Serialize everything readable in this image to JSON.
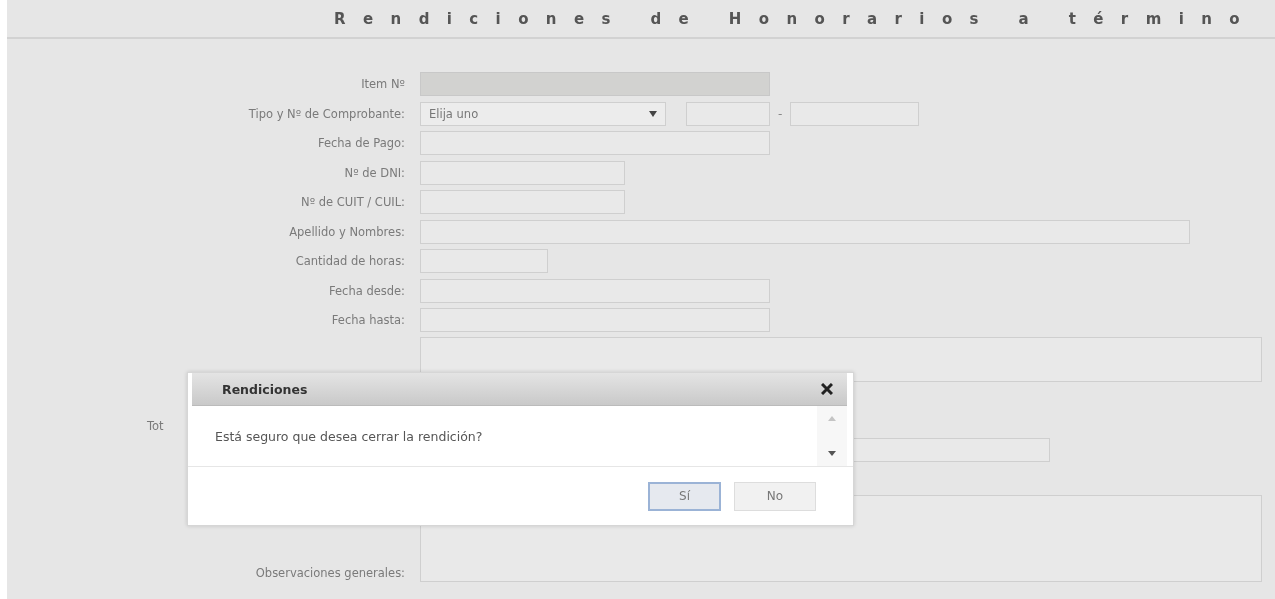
{
  "title": "Rendiciones de Honorarios a término",
  "form": [
    {
      "kind": "medium",
      "label": "Item Nº",
      "disabled": true
    },
    {
      "kind": "select-pair",
      "label": "Tipo y Nº de Comprobante:",
      "select": "Elija uno",
      "separator": "-"
    },
    {
      "kind": "medium",
      "label": "Fecha de Pago:",
      "disabled": false
    },
    {
      "kind": "short",
      "label": "Nº de DNI:",
      "disabled": false
    },
    {
      "kind": "short",
      "label": "Nº de CUIT / CUIL:",
      "disabled": false
    },
    {
      "kind": "long",
      "label": "Apellido y Nombres:",
      "disabled": false
    },
    {
      "kind": "tiny",
      "label": "Cantidad de horas:",
      "disabled": false
    },
    {
      "kind": "medium",
      "label": "Fecha desde:",
      "disabled": false
    },
    {
      "kind": "medium",
      "label": "Fecha hasta:",
      "disabled": false
    },
    {
      "kind": "textarea"
    },
    {
      "kind": "covered-label",
      "label": "Tot"
    },
    {
      "kind": "wide",
      "disabled": false
    },
    {
      "kind": "textarea",
      "label": "Observaciones generales:"
    }
  ],
  "dialog": {
    "title": "Rendiciones",
    "message": "Está seguro que desea cerrar la rendición?",
    "buttons": [
      {
        "label": "Sí",
        "selected": true
      },
      {
        "label": "No",
        "selected": false
      }
    ]
  }
}
